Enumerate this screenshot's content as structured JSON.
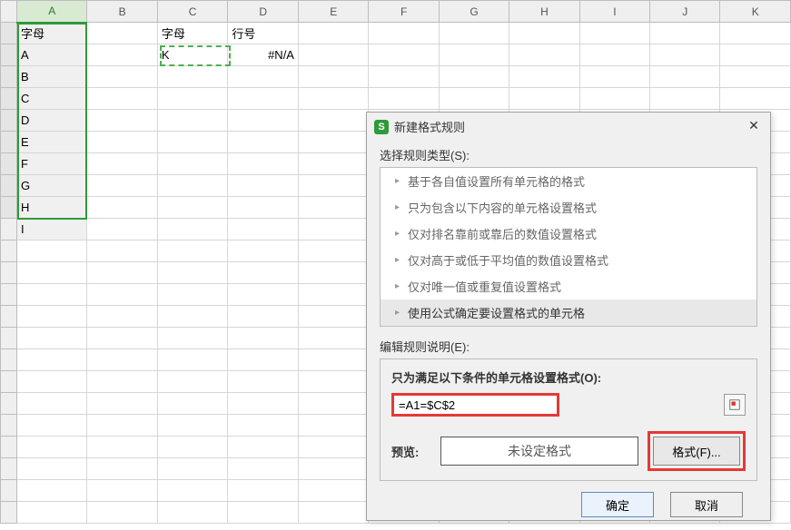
{
  "sheet": {
    "columns": [
      "A",
      "B",
      "C",
      "D",
      "E",
      "F",
      "G",
      "H",
      "I",
      "J",
      "K"
    ],
    "cells": {
      "A1": "字母",
      "C1": "字母",
      "D1": "行号",
      "A2": "A",
      "C2": "K",
      "D2": "#N/A",
      "A3": "B",
      "A4": "C",
      "A5": "D",
      "A6": "E",
      "A7": "F",
      "A8": "G",
      "A9": "H",
      "A10": "I"
    }
  },
  "dialog": {
    "title": "新建格式规则",
    "select_type_label": "选择规则类型(S):",
    "rule_types": [
      "基于各自值设置所有单元格的格式",
      "只为包含以下内容的单元格设置格式",
      "仅对排名靠前或靠后的数值设置格式",
      "仅对高于或低于平均值的数值设置格式",
      "仅对唯一值或重复值设置格式",
      "使用公式确定要设置格式的单元格"
    ],
    "selected_rule_index": 5,
    "edit_label": "编辑规则说明(E):",
    "condition_label": "只为满足以下条件的单元格设置格式(O):",
    "formula": "=A1=$C$2",
    "preview_label": "预览:",
    "preview_text": "未设定格式",
    "format_btn": "格式(F)...",
    "ok": "确定",
    "cancel": "取消"
  }
}
